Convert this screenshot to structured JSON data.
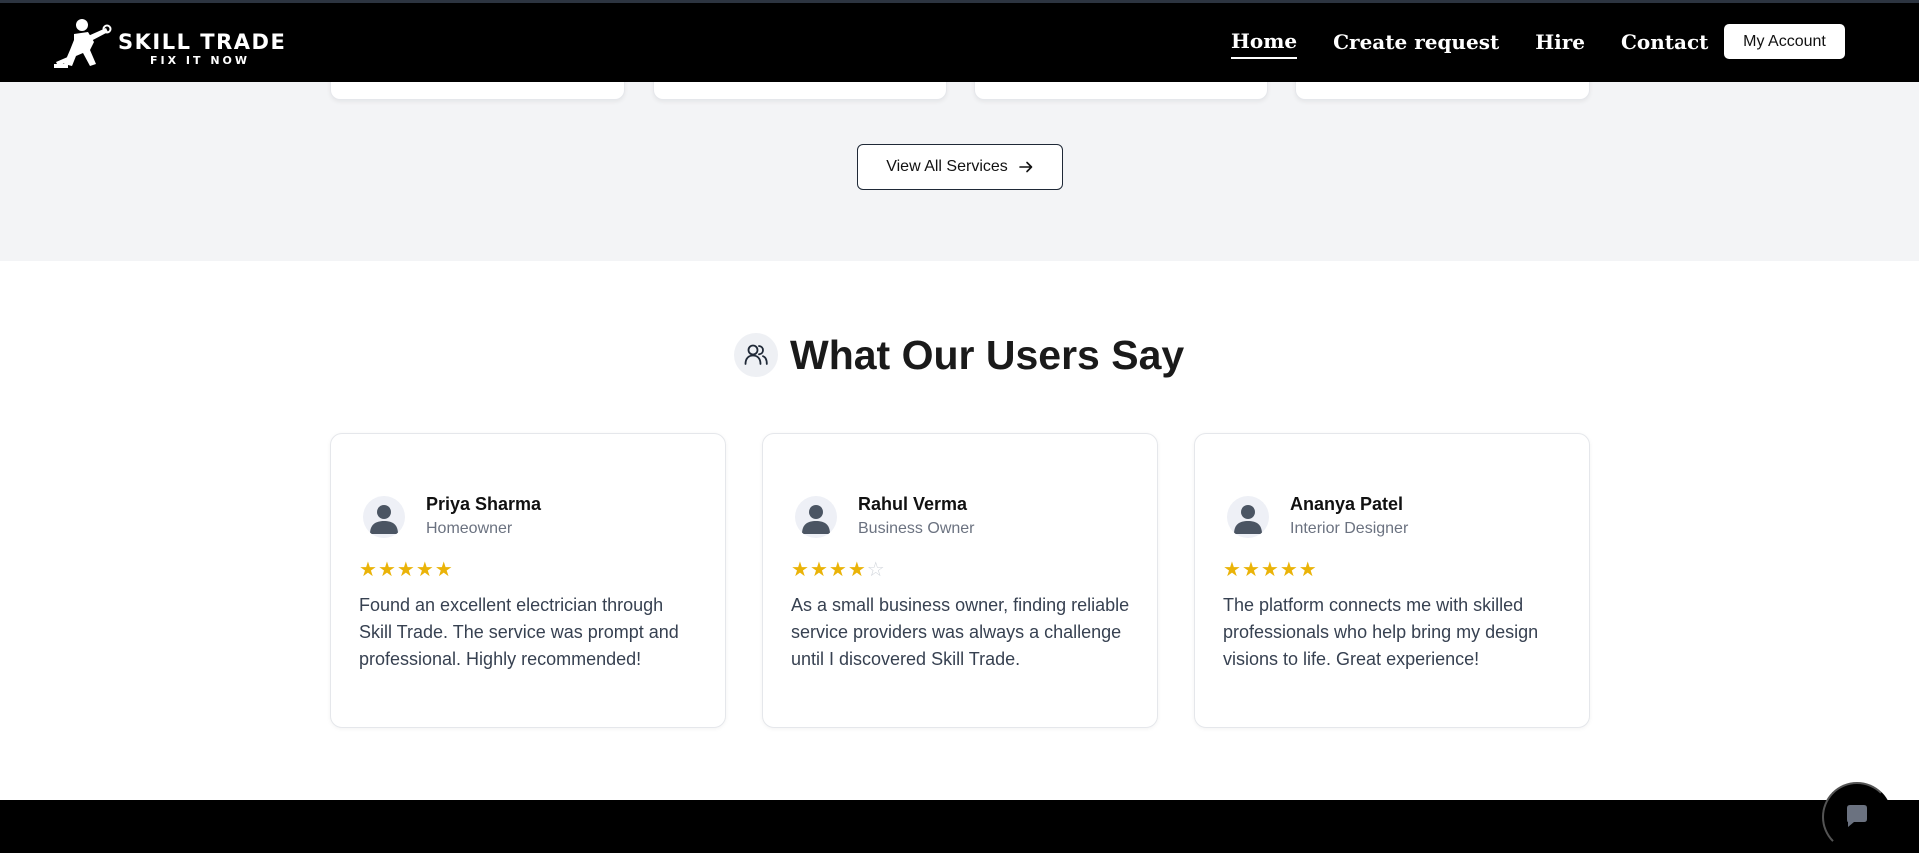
{
  "brand": {
    "title": "SKILL TRADE",
    "tagline": "FIX IT NOW"
  },
  "nav": {
    "links": [
      "Home",
      "Create request",
      "Hire",
      "Contact"
    ],
    "active": "Home",
    "account_label": "My Account"
  },
  "services": {
    "view_all_label": "View All Services"
  },
  "testimonials": {
    "heading": "What Our Users Say",
    "items": [
      {
        "name": "Priya Sharma",
        "role": "Homeowner",
        "rating": 5,
        "text": "Found an excellent electrician through Skill Trade. The service was prompt and professional. Highly recommended!"
      },
      {
        "name": "Rahul Verma",
        "role": "Business Owner",
        "rating": 4,
        "text": "As a small business owner, finding reliable service providers was always a challenge until I discovered Skill Trade."
      },
      {
        "name": "Ananya Patel",
        "role": "Interior Designer",
        "rating": 5,
        "text": "The platform connects me with skilled professionals who help bring my design visions to life. Great experience!"
      }
    ]
  },
  "colors": {
    "star": "#eab308",
    "navbar": "#000000",
    "section_bg": "#f3f4f6"
  },
  "icons": {
    "logo": "worker-with-wrench-icon",
    "heading": "users-icon",
    "view_all": "arrow-right-icon",
    "avatar": "user-icon",
    "chat": "chat-bubble-icon"
  }
}
